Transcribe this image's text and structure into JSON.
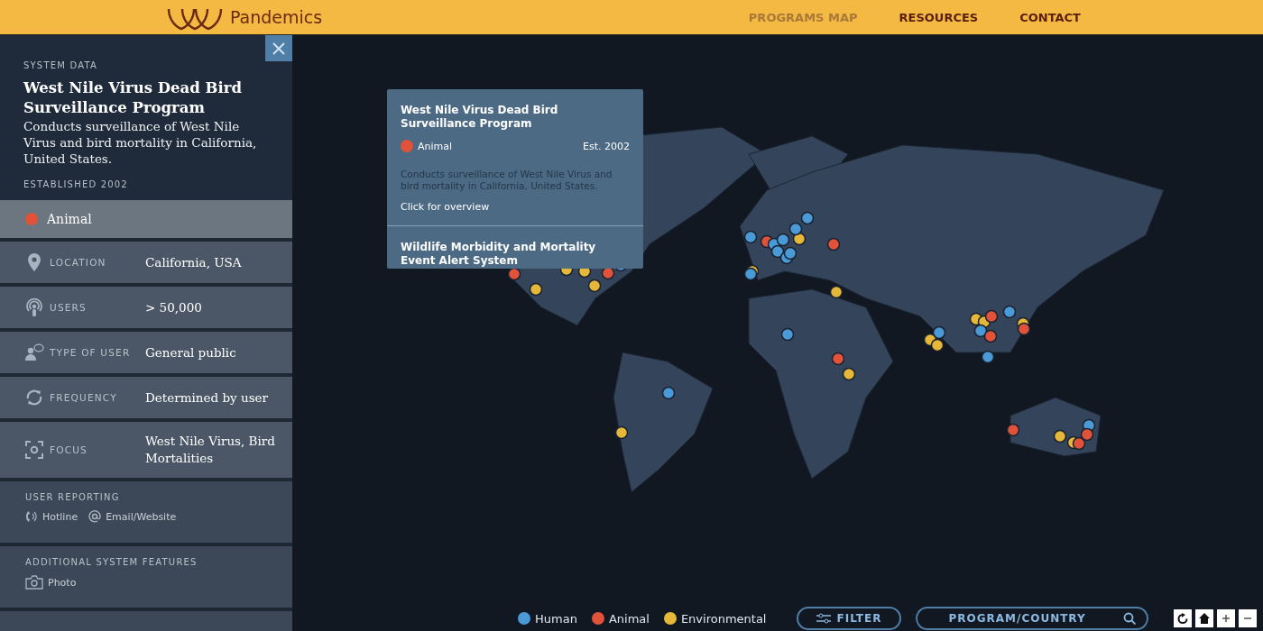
{
  "header": {
    "logo_text": "Pandemics",
    "nav": [
      {
        "label": "PROGRAMS MAP",
        "selected": true
      },
      {
        "label": "RESOURCES",
        "selected": false
      },
      {
        "label": "CONTACT",
        "selected": false
      }
    ]
  },
  "panel": {
    "section_label": "SYSTEM DATA",
    "title": "West Nile Virus Dead Bird Surveillance Program",
    "description": "Conducts surveillance of West Nile Virus and bird mortality in California, United States.",
    "established": "ESTABLISHED 2002",
    "category": {
      "label": "Animal",
      "color": "#e0533a"
    },
    "fields": [
      {
        "kind": "location",
        "label": "LOCATION",
        "value": "California, USA"
      },
      {
        "kind": "users",
        "label": "USERS",
        "value": "> 50,000"
      },
      {
        "kind": "user_type",
        "label": "TYPE OF USER",
        "value": "General public"
      },
      {
        "kind": "frequency",
        "label": "FREQUENCY",
        "value": "Determined by user"
      },
      {
        "kind": "focus",
        "label": "FOCUS",
        "value": "West Nile Virus, Bird Mortalities"
      }
    ],
    "sections": [
      {
        "heading": "USER REPORTING",
        "items": [
          {
            "kind": "phone",
            "label": "Hotline"
          },
          {
            "kind": "email",
            "label": "Email/Website"
          }
        ]
      },
      {
        "heading": "ADDITIONAL SYSTEM FEATURES",
        "items": [
          {
            "kind": "camera",
            "label": "Photo"
          }
        ]
      }
    ]
  },
  "popup": {
    "items": [
      {
        "title": "West Nile Virus Dead Bird Surveillance Program",
        "category": "Animal",
        "color": "#e0533a",
        "established": "Est. 2002",
        "description": "Conducts surveillance of West Nile Virus and bird mortality in California, United States.",
        "link": "Click for overview"
      },
      {
        "title": "Wildlife Morbidity and Mortality Event Alert System"
      }
    ]
  },
  "legend": [
    {
      "label": "Human",
      "color": "#4a9ad8"
    },
    {
      "label": "Animal",
      "color": "#e0533a"
    },
    {
      "label": "Environmental",
      "color": "#e6b83a"
    }
  ],
  "filter_button": "FILTER",
  "search": {
    "placeholder": "PROGRAM/COUNTRY"
  }
}
